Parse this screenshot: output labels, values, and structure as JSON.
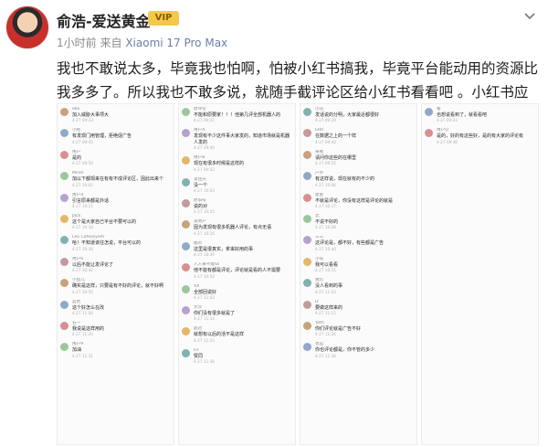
{
  "post": {
    "user_name": "俞浩-爱送黄金",
    "badge": "VIP",
    "time": "1小时前",
    "source_prefix": "来自",
    "source": "Xiaomi 17 Pro Max",
    "text": "我也不敢说太多，毕竟我也怕啊，怕被小红书搞我，毕竟平台能动用的资源比我多多了。所以我也不敢多说，就随手截评论区给小红书看看吧 。小红书应该正视！"
  },
  "colors": {
    "accent": "#6b7ea8",
    "badge": "#f3c94b"
  },
  "screenshots": [
    {
      "comments": [
        {
          "name": "ebs",
          "text": "加入威胁大事项大",
          "time": "4-27 09:33"
        },
        {
          "name": "小程",
          "text": "有发现门用管理，拒绝促广告",
          "time": "4-27 09:45"
        },
        {
          "name": "用户",
          "text": "是的",
          "time": "4-27 09:50"
        },
        {
          "name": "Miner",
          "text": "加以下都现来在有有不成评论区，因此出来个",
          "time": "4-27 10:02"
        },
        {
          "name": "用户4",
          "text": "引言原来都是外话",
          "time": "4-27 10:11"
        },
        {
          "name": "Jack",
          "text": "这个是大家自己平台不要可以的",
          "time": "4-27 10:18"
        },
        {
          "name": "Leo Cafeasyem",
          "text": "哈！不知道该往怎说，平台可以的",
          "time": "4-27 10:30"
        },
        {
          "name": "用户6",
          "text": "以后不能让发评论了",
          "time": "4-27 10:42"
        },
        {
          "name": "小鱼儿",
          "text": "确实是这样，只要是有不好的评论，就不好啊",
          "time": "4-27 10:55"
        },
        {
          "name": "蓝色",
          "text": "这个好怎么在改",
          "time": "4-27 11:08"
        },
        {
          "name": "石一",
          "text": "我说是这样用的",
          "time": "4-27 11:20"
        },
        {
          "name": "用户9",
          "text": "加油",
          "time": "4-27 11:31"
        }
      ]
    },
    {
      "comments": [
        {
          "name": "原评论",
          "text": "不能和原要家！！！他第几评全部机器人的",
          "time": "4-27 09:31"
        },
        {
          "name": "用户A",
          "text": "发现有不少这件事大家发的，知道市场就是机器人发的",
          "time": "4-27 09:40"
        },
        {
          "name": "用户B",
          "text": "现在有很多时候是这样的",
          "time": "4-27 09:52"
        },
        {
          "name": "李佳卉",
          "text": "没一个",
          "time": "4-27 10:03"
        },
        {
          "name": "原旧号",
          "text": "说的对",
          "time": "4-27 10:15"
        },
        {
          "name": "某用户",
          "text": "因为发现有很多机器人评论，有点无语",
          "time": "4-27 10:26"
        },
        {
          "name": "都市",
          "text": "这里是很真实，拿来好用的事",
          "time": "4-27 10:39"
        },
        {
          "name": "人人来不能Ss",
          "text": "他不能有都是评论，评论就是看的人不需要",
          "time": "4-27 10:50"
        },
        {
          "name": "XX",
          "text": "全部回说好",
          "time": "4-27 11:02"
        },
        {
          "name": "大众",
          "text": "你们没有很多就是了",
          "time": "4-27 11:14"
        },
        {
          "name": "超过",
          "text": "就想有以后的活不是这样",
          "time": "4-27 11:25"
        },
        {
          "name": "Fit",
          "text": "赞同",
          "time": "4-27 11:36"
        }
      ]
    },
    {
      "comments": [
        {
          "name": "小花",
          "text": "发话说的分明，大家最近都很好",
          "time": "4-27 09:29"
        },
        {
          "name": "ERR",
          "text": "在数据之上的一个样",
          "time": "4-27 09:42"
        },
        {
          "name": "来看",
          "text": "请问你这些的在哪里",
          "time": "4-27 09:55"
        },
        {
          "name": "户外",
          "text": "有这样说，现在就有的不少的",
          "time": "4-27 10:06"
        },
        {
          "name": "星星",
          "text": "不就是评论，你没有这样是评论的就是",
          "time": "4-27 10:17"
        },
        {
          "name": "北",
          "text": "不说不好的",
          "time": "4-27 10:28"
        },
        {
          "name": "三三",
          "text": "这评论是，都不好，有些都是广告",
          "time": "4-27 10:40"
        },
        {
          "name": "小号",
          "text": "我可以看看",
          "time": "4-27 10:51"
        },
        {
          "name": "我们",
          "text": "没人看到的事",
          "time": "4-27 11:03"
        },
        {
          "name": "D",
          "text": "要做这样来的",
          "time": "4-27 11:15"
        },
        {
          "name": "Yeth",
          "text": "你们评论就是广告不好",
          "time": "4-27 11:26"
        },
        {
          "name": "也是",
          "text": "你也评论都是，你不管的多少",
          "time": "4-27 11:38"
        }
      ]
    },
    {
      "comments": [
        {
          "name": "看",
          "text": "也想说看到了，就看看吧",
          "time": "4-27 09:33"
        },
        {
          "name": "用户Q",
          "text": "是的，好的有这些好，是的有大家的评论有",
          "time": "4-27 09:46"
        },
        {
          "name": "",
          "text": "",
          "time": ""
        }
      ]
    }
  ]
}
